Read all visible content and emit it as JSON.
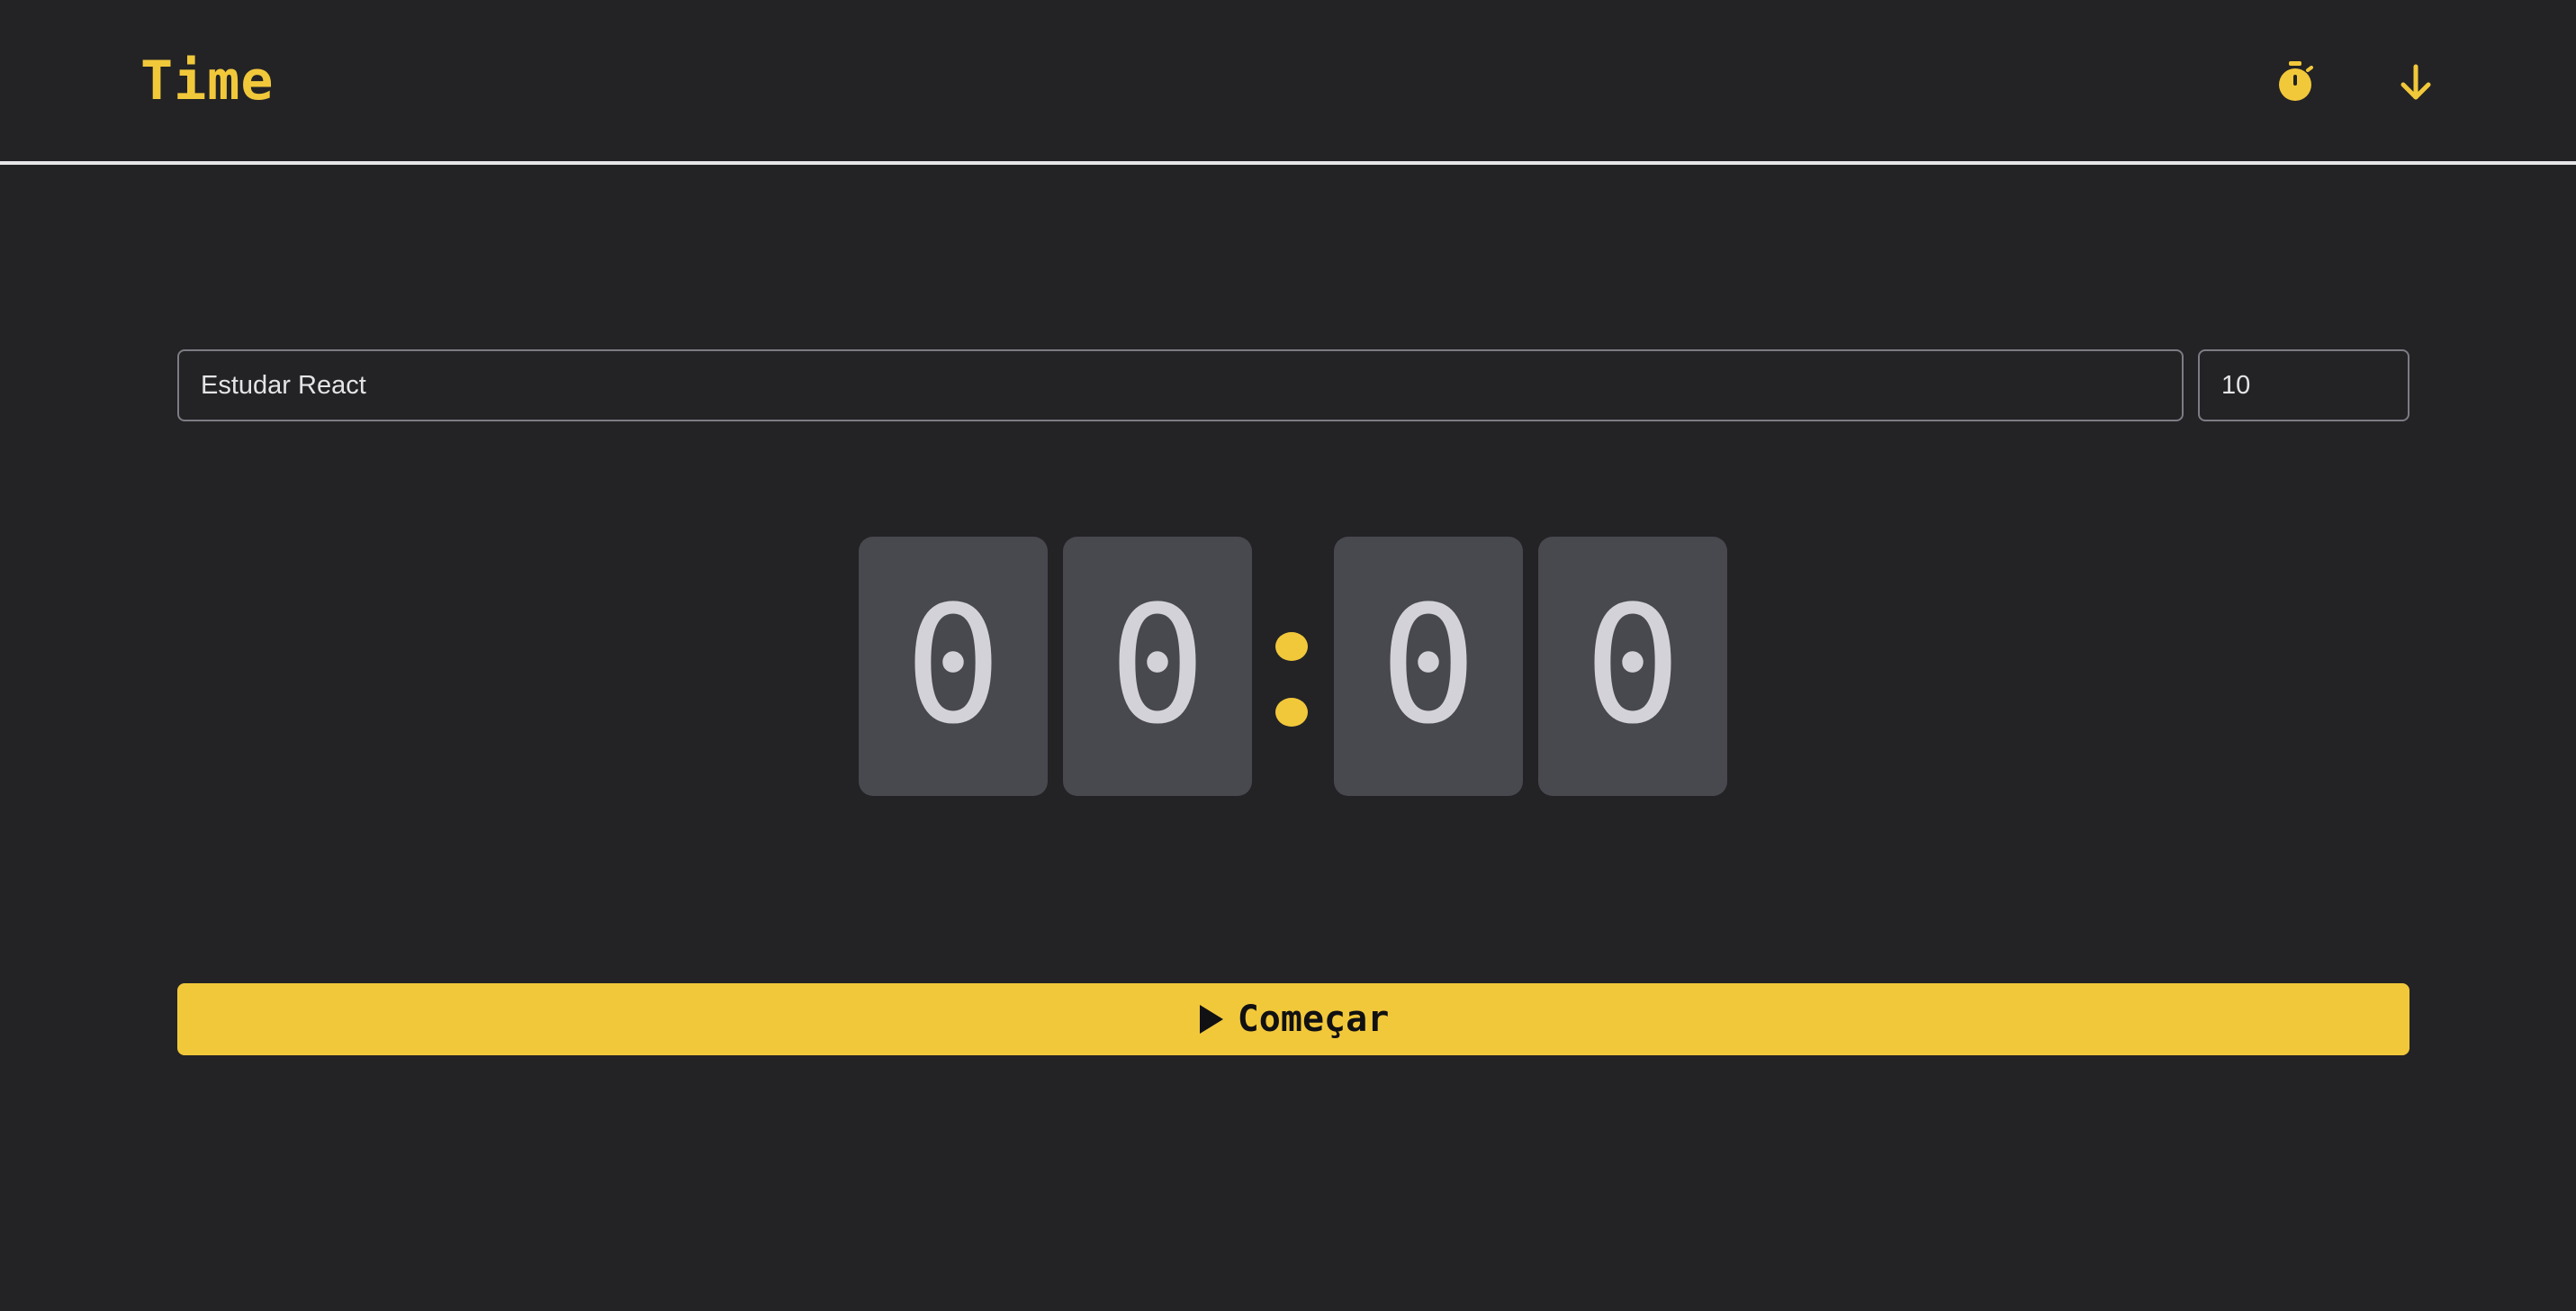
{
  "header": {
    "brand": "Time",
    "nav": [
      {
        "icon": "timer-icon"
      },
      {
        "icon": "history-arrow-down-icon"
      }
    ]
  },
  "form": {
    "task_value": "Estudar React",
    "minutes_value": "10"
  },
  "countdown": {
    "digits": [
      "0",
      "0",
      "0",
      "0"
    ],
    "separator": ":"
  },
  "start_button": {
    "label": "Começar",
    "icon": "play-icon"
  },
  "colors": {
    "background": "#232325",
    "accent": "#f2c83b",
    "digit_bg": "#48484f",
    "digit_text": "#d2d2d8"
  }
}
